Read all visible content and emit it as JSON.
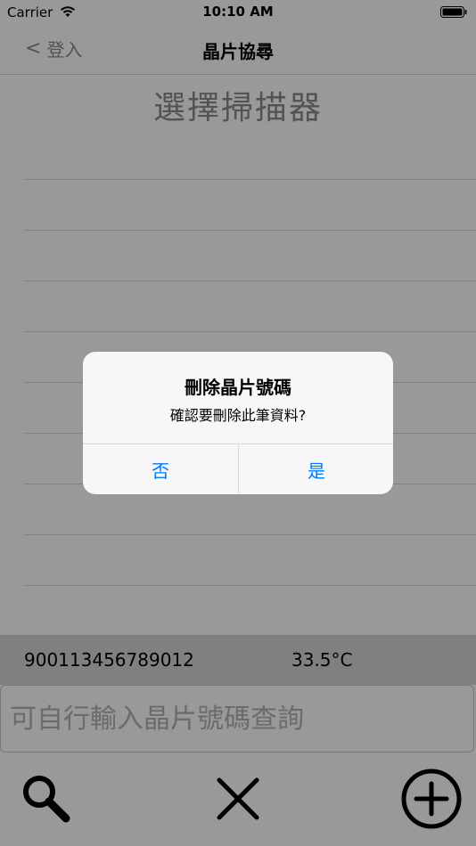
{
  "status_bar": {
    "carrier": "Carrier",
    "time": "10:10 AM",
    "wifi_icon": "wifi-icon",
    "battery_icon": "battery-icon"
  },
  "nav": {
    "back_label": "登入",
    "back_chevron": "<",
    "title": "晶片協尋"
  },
  "main": {
    "heading": "選擇掃描器"
  },
  "result": {
    "chip_number": "900113456789012",
    "temperature": "33.5°C"
  },
  "search": {
    "placeholder": "可自行輸入晶片號碼查詢"
  },
  "toolbar": {
    "icons": [
      "search-icon",
      "close-icon",
      "add-circle-icon"
    ]
  },
  "alert": {
    "title": "刪除晶片號碼",
    "message": "確認要刪除此筆資料?",
    "no_label": "否",
    "yes_label": "是"
  },
  "colors": {
    "accent": "#007aff",
    "overlay": "rgba(0,0,0,0.40)",
    "result_bar": "#d6d6d6"
  }
}
